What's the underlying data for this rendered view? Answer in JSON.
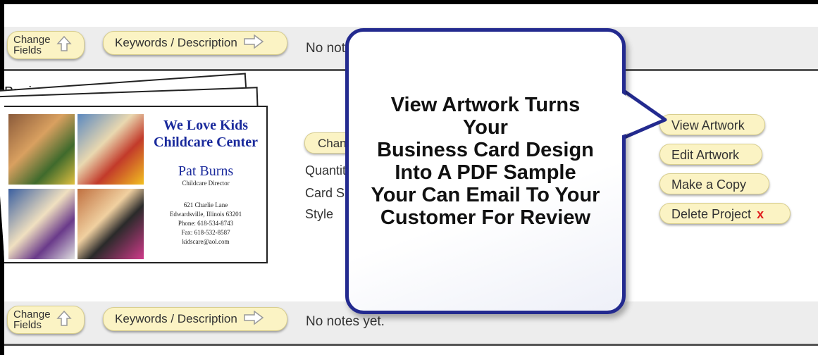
{
  "top_bar": {
    "change_fields": [
      "Change",
      "Fields"
    ],
    "keywords_label": "Keywords / Description",
    "notes": "No notes yet."
  },
  "section": {
    "title": "Business Cards"
  },
  "business_card": {
    "title_line1": "We Love Kids",
    "title_line2": "Childcare Center",
    "name": "Pat Burns",
    "role": "Childcare Director",
    "address1": "621 Charlie Lane",
    "address2": "Edwardsville, Illinois 63201",
    "phone": "Phone: 618-534-8743",
    "fax": "Fax: 618-532-8587",
    "email": "kidscare@aol.com"
  },
  "details": {
    "change_button": "Change",
    "quantity_label": "Quantity",
    "card_size_label": "Card Size",
    "style_label": "Style"
  },
  "actions": {
    "view_artwork": "View Artwork",
    "edit_artwork": "Edit Artwork",
    "make_copy": "Make a Copy",
    "delete_project": "Delete Project",
    "delete_mark": "x"
  },
  "callout": {
    "lines": [
      "View Artwork Turns",
      "Your",
      "Business Card Design",
      "Into A PDF Sample",
      "Your Can Email To Your",
      "Customer For Review"
    ]
  },
  "bottom_bar": {
    "change_fields": [
      "Change",
      "Fields"
    ],
    "keywords_label": "Keywords / Description",
    "notes": "No notes yet."
  },
  "colors": {
    "button_bg": "#fbf3c4",
    "callout_border": "#232a8f",
    "delete_x": "#e01b1b",
    "card_title": "#1a2a9c"
  }
}
